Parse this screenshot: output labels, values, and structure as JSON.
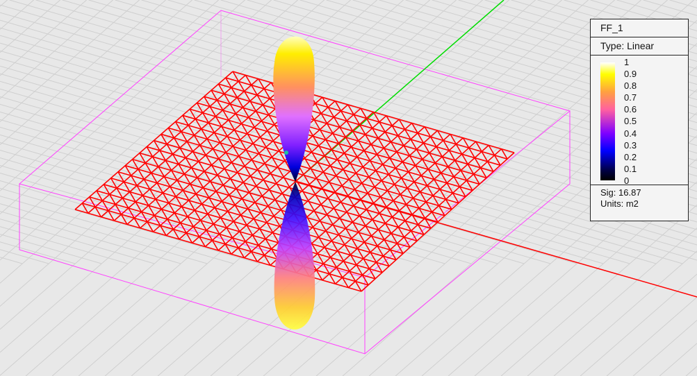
{
  "legend": {
    "title": "FF_1",
    "type_label": "Type: Linear",
    "ticks": [
      "1",
      "0.9",
      "0.8",
      "0.7",
      "0.6",
      "0.5",
      "0.4",
      "0.3",
      "0.2",
      "0.1",
      "0"
    ],
    "sig_label": "Sig: 16.87",
    "units_label": "Units: m2"
  },
  "colors": {
    "mesh": "#ff0000",
    "box": "#ff40ff",
    "axis_y": "#00dd00",
    "axis_x": "#ff0000"
  }
}
